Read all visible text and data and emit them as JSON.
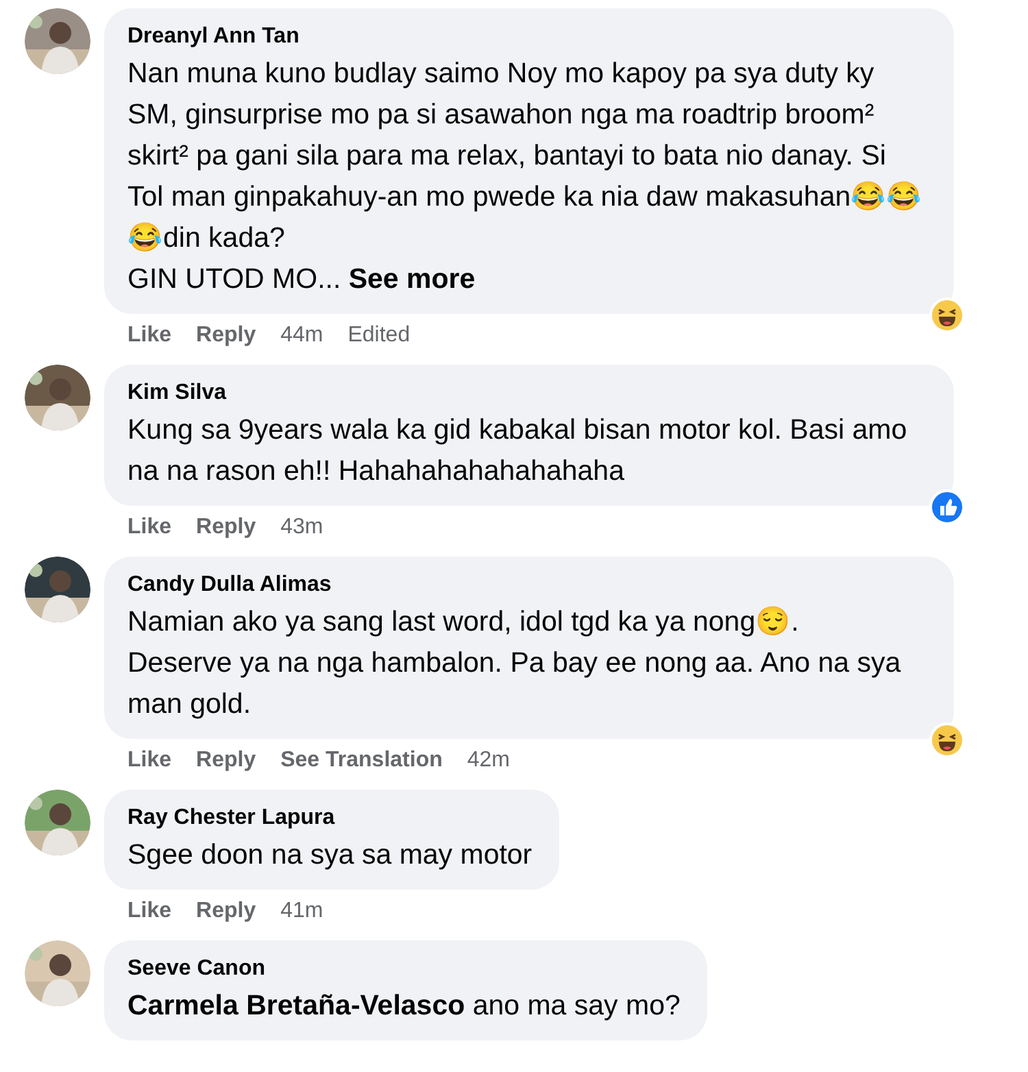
{
  "comments": [
    {
      "name": "Dreanyl Ann Tan",
      "avatar": {
        "kind": "picture"
      },
      "text": "Nan muna kuno budlay saimo Noy mo kapoy pa sya duty ky SM, ginsurprise mo pa si asawahon nga ma roadtrip broom² skirt² pa gani sila para ma relax, bantayi to bata nio danay. Si Tol man ginpakahuy-an mo pwede ka nia daw makasuhan😂😂😂din kada?\nGIN UTOD MO...",
      "see_more": "See more",
      "reaction": {
        "kind": "haha"
      },
      "actions": [
        {
          "label": "Like",
          "kind": "link"
        },
        {
          "label": "Reply",
          "kind": "link"
        },
        {
          "label": "44m",
          "kind": "time"
        },
        {
          "label": "Edited",
          "kind": "time"
        }
      ]
    },
    {
      "name": "Kim Silva",
      "avatar": {
        "kind": "picture"
      },
      "text": "Kung sa 9years wala ka gid kabakal bisan motor kol. Basi amo na na rason eh!! Hahahahahahahahaha",
      "reaction": {
        "kind": "like"
      },
      "actions": [
        {
          "label": "Like",
          "kind": "link"
        },
        {
          "label": "Reply",
          "kind": "link"
        },
        {
          "label": "43m",
          "kind": "time"
        }
      ]
    },
    {
      "name": "Candy Dulla Alimas",
      "avatar": {
        "kind": "picture"
      },
      "text": "Namian ako ya sang last word, idol tgd ka ya nong😌.\nDeserve ya na nga hambalon. Pa bay ee nong aa. Ano na sya man gold.",
      "reaction": {
        "kind": "haha"
      },
      "actions": [
        {
          "label": "Like",
          "kind": "link"
        },
        {
          "label": "Reply",
          "kind": "link"
        },
        {
          "label": "See Translation",
          "kind": "link"
        },
        {
          "label": "42m",
          "kind": "time"
        }
      ]
    },
    {
      "name": "Ray Chester Lapura",
      "avatar": {
        "kind": "picture"
      },
      "text": "Sgee doon na sya sa may motor",
      "actions": [
        {
          "label": "Like",
          "kind": "link"
        },
        {
          "label": "Reply",
          "kind": "link"
        },
        {
          "label": "41m",
          "kind": "time"
        }
      ]
    },
    {
      "name": "Seeve Canon",
      "avatar": {
        "kind": "picture"
      },
      "text": "**Carmela Bretaña-Velasco** ano ma say mo?"
    }
  ]
}
